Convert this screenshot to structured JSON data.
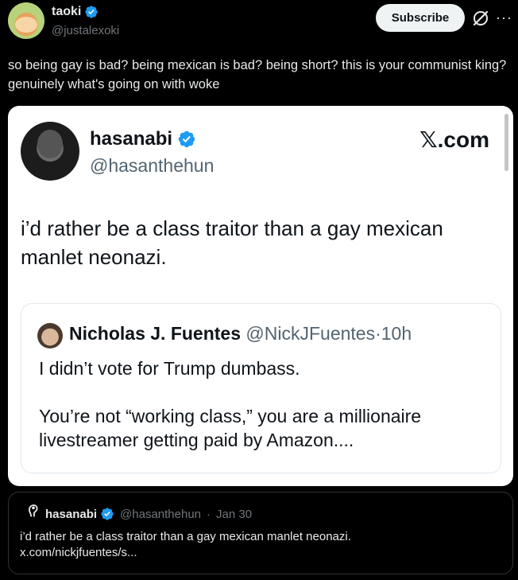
{
  "author": {
    "name": "taoki",
    "handle": "@justalexoki",
    "verified": true
  },
  "actions": {
    "subscribe_label": "Subscribe",
    "grok_icon": "grok-icon",
    "more_icon": "more-icon",
    "more_glyph": "···"
  },
  "tweet": {
    "text": "so being gay is bad? being mexican is bad? being short? this is your communist king? genuinely what's going on with woke"
  },
  "media": {
    "screenshot": {
      "name": "hasanabi",
      "handle": "@hasanthehun",
      "site": "𝕏.com",
      "text": "i’d rather be a class traitor than a gay mexican manlet neonazi.",
      "quote": {
        "name": "Nicholas J. Fuentes",
        "handle": "@NickJFuentes",
        "time": "10h",
        "paragraph1": "I didn’t vote for Trump dumbass.",
        "paragraph2": "You’re not “working class,” you are a millionaire livestreamer getting paid by Amazon...."
      }
    }
  },
  "quoted_card": {
    "name": "hasanabi",
    "handle": "@hasanthehun",
    "date": "Jan 30",
    "separator": "·",
    "text_line1": "i’d rather be a class traitor than a gay mexican manlet neonazi.",
    "text_line2": "x.com/nickjfuentes/s..."
  },
  "colors": {
    "verified": "#1d9bf0",
    "background": "#000000",
    "subscribe_bg": "#eff3f4"
  }
}
